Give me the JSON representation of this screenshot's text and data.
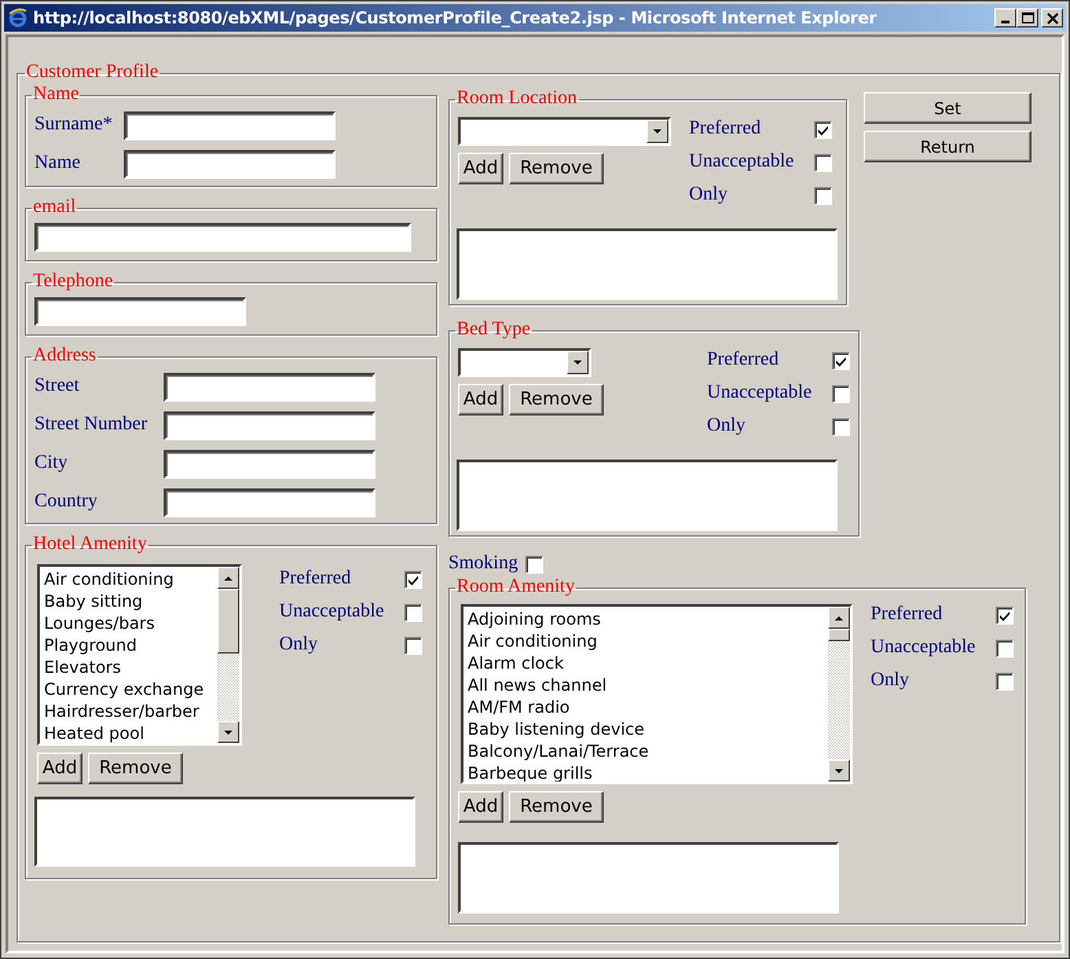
{
  "window": {
    "title": "http://localhost:8080/ebXML/pages/CustomerProfile_Create2.jsp - Microsoft Internet Explorer"
  },
  "form": {
    "legend": "Customer Profile"
  },
  "name_section": {
    "legend": "Name",
    "fields": [
      {
        "label": "Surname*"
      },
      {
        "label": "Name"
      }
    ]
  },
  "email": {
    "legend": "email"
  },
  "telephone": {
    "legend": "Telephone"
  },
  "address": {
    "legend": "Address",
    "fields": [
      {
        "label": "Street"
      },
      {
        "label": "Street Number"
      },
      {
        "label": "City"
      },
      {
        "label": "Country"
      }
    ]
  },
  "hotel_amenity": {
    "legend": "Hotel Amenity",
    "options": [
      "Air conditioning",
      "Baby sitting",
      "Lounges/bars",
      "Playground",
      "Elevators",
      "Currency exchange",
      "Hairdresser/barber",
      "Heated pool"
    ],
    "add": "Add",
    "remove": "Remove",
    "preferences": [
      {
        "label": "Preferred",
        "checked": true
      },
      {
        "label": "Unacceptable",
        "checked": false
      },
      {
        "label": "Only",
        "checked": false
      }
    ]
  },
  "room_location": {
    "legend": "Room Location",
    "add": "Add",
    "remove": "Remove",
    "preferences": [
      {
        "label": "Preferred",
        "checked": true
      },
      {
        "label": "Unacceptable",
        "checked": false
      },
      {
        "label": "Only",
        "checked": false
      }
    ]
  },
  "bed_type": {
    "legend": "Bed Type",
    "add": "Add",
    "remove": "Remove",
    "preferences": [
      {
        "label": "Preferred",
        "checked": true
      },
      {
        "label": "Unacceptable",
        "checked": false
      },
      {
        "label": "Only",
        "checked": false
      }
    ]
  },
  "smoking": {
    "label": "Smoking",
    "checked": false
  },
  "room_amenity": {
    "legend": "Room Amenity",
    "options": [
      "Adjoining rooms",
      "Air conditioning",
      "Alarm clock",
      "All news channel",
      "AM/FM radio",
      "Baby listening device",
      "Balcony/Lanai/Terrace",
      "Barbeque grills"
    ],
    "add": "Add",
    "remove": "Remove",
    "preferences": [
      {
        "label": "Preferred",
        "checked": true
      },
      {
        "label": "Unacceptable",
        "checked": false
      },
      {
        "label": "Only",
        "checked": false
      }
    ]
  },
  "buttons": [
    "Set",
    "Return"
  ]
}
